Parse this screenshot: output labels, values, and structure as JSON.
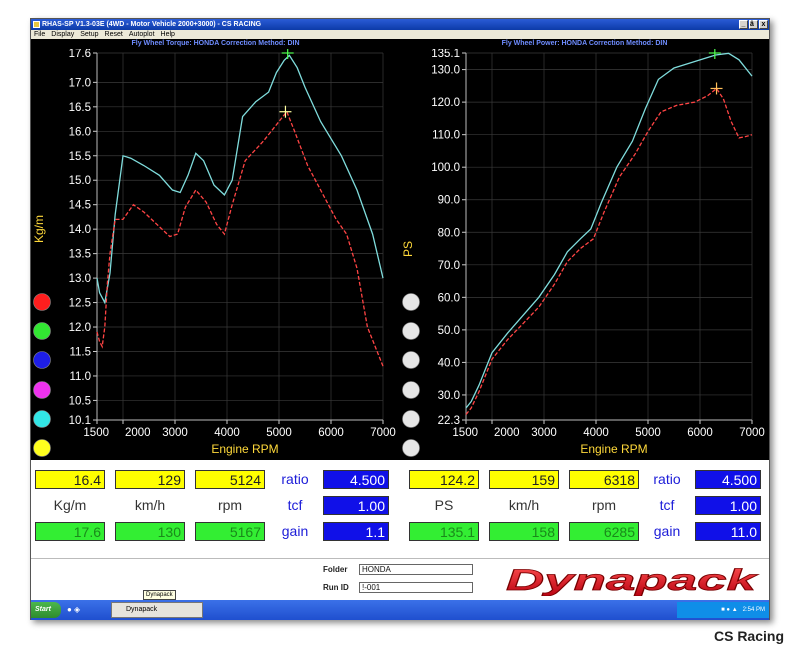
{
  "window": {
    "title": "RHAS-SP V1.3-03E (4WD - Motor Vehicle 2000+3000) - CS RACING",
    "menu": [
      "File",
      "Display",
      "Setup",
      "Reset",
      "Autoplot",
      "Help"
    ],
    "controls": [
      "_",
      "â¡",
      "x"
    ]
  },
  "torque_panel": {
    "title": "Fly Wheel Torque: HONDA     Correction Method: DIN"
  },
  "power_panel": {
    "title": "Fly Wheel Power: HONDA     Correction Method: DIN"
  },
  "chart_data": [
    {
      "type": "line",
      "title": "Fly Wheel Torque: HONDA     Correction Method: DIN",
      "xlabel": "Engine RPM",
      "ylabel": "Kg/m",
      "xlim": [
        1500,
        7000
      ],
      "ylim": [
        10.1,
        17.6
      ],
      "xticks": [
        1500,
        2000,
        3000,
        4000,
        5000,
        6000,
        7000
      ],
      "yticks": [
        10.1,
        10.5,
        11.0,
        11.5,
        12.0,
        12.5,
        13.0,
        13.5,
        14.0,
        14.5,
        15.0,
        15.5,
        16.0,
        16.5,
        17.0,
        17.6
      ],
      "grid": true,
      "series": [
        {
          "color": "#7fdcdc",
          "dash": false,
          "x": [
            1500,
            1550,
            1650,
            1750,
            1850,
            2000,
            2150,
            2400,
            2700,
            2950,
            3100,
            3250,
            3400,
            3550,
            3750,
            3950,
            4100,
            4300,
            4550,
            4800,
            4950,
            5100,
            5200,
            5350,
            5500,
            5800,
            6200,
            6500,
            6800,
            7000
          ],
          "y": [
            13.0,
            12.7,
            12.5,
            13.1,
            14.3,
            15.5,
            15.45,
            15.3,
            15.1,
            14.8,
            14.75,
            15.1,
            15.55,
            15.4,
            14.9,
            14.7,
            15.0,
            16.3,
            16.6,
            16.8,
            17.2,
            17.45,
            17.55,
            17.3,
            16.9,
            16.2,
            15.5,
            14.8,
            13.9,
            13.0
          ]
        },
        {
          "color": "#ff4444",
          "dash": true,
          "x": [
            1500,
            1550,
            1600,
            1650,
            1700,
            1750,
            1850,
            2000,
            2200,
            2400,
            2650,
            2900,
            3050,
            3200,
            3400,
            3600,
            3800,
            3950,
            4100,
            4350,
            4700,
            5000,
            5150,
            5300,
            5550,
            5850,
            6100,
            6300,
            6500,
            6700,
            6850,
            7000
          ],
          "y": [
            11.9,
            11.7,
            11.6,
            12.0,
            12.9,
            13.5,
            14.2,
            14.2,
            14.5,
            14.35,
            14.1,
            13.85,
            13.9,
            14.45,
            14.8,
            14.55,
            14.1,
            13.9,
            14.5,
            15.4,
            15.8,
            16.2,
            16.4,
            16.0,
            15.3,
            14.7,
            14.2,
            13.9,
            13.2,
            12.0,
            11.6,
            11.2
          ]
        }
      ],
      "markers": [
        {
          "x": 5167,
          "y": 17.6,
          "color": "#50ff50"
        },
        {
          "x": 5124,
          "y": 16.4,
          "color": "#ffffa0"
        }
      ],
      "legend_dots": [
        "#ff1e1e",
        "#32e632",
        "#1e1ee6",
        "#ee32ee",
        "#32e6e6",
        "#ffff1e"
      ]
    },
    {
      "type": "line",
      "title": "Fly Wheel Power: HONDA     Correction Method: DIN",
      "xlabel": "Engine RPM",
      "ylabel": "PS",
      "xlim": [
        1500,
        7000
      ],
      "ylim": [
        22.3,
        135.1
      ],
      "xticks": [
        1500,
        2000,
        3000,
        4000,
        5000,
        6000,
        7000
      ],
      "yticks": [
        22.3,
        30.0,
        40.0,
        50.0,
        60.0,
        70.0,
        80.0,
        90.0,
        100.0,
        110.0,
        120.0,
        130.0,
        135.1
      ],
      "grid": true,
      "series": [
        {
          "color": "#7fdcdc",
          "dash": false,
          "x": [
            1500,
            1600,
            1750,
            2000,
            2300,
            2600,
            2900,
            3200,
            3450,
            3700,
            3900,
            4100,
            4400,
            4700,
            4950,
            5200,
            5500,
            5800,
            6100,
            6300,
            6550,
            6750,
            7000
          ],
          "y": [
            26.0,
            28.0,
            33.0,
            43.0,
            49.0,
            54.5,
            60.0,
            67.0,
            74.0,
            78.0,
            81.0,
            89.0,
            100.0,
            108.0,
            118.0,
            127.0,
            130.5,
            132.0,
            133.5,
            134.5,
            135.0,
            133.0,
            128.0
          ]
        },
        {
          "color": "#ff4444",
          "dash": true,
          "x": [
            1500,
            1600,
            1750,
            2000,
            2300,
            2600,
            2900,
            3200,
            3450,
            3700,
            3950,
            4150,
            4450,
            4750,
            5000,
            5250,
            5550,
            5900,
            6150,
            6318,
            6450,
            6600,
            6750,
            6900,
            7000
          ],
          "y": [
            24.0,
            26.0,
            31.0,
            41.0,
            47.0,
            52.0,
            57.0,
            64.0,
            71.0,
            75.0,
            78.0,
            86.0,
            97.0,
            104.0,
            111.0,
            117.0,
            119.0,
            120.0,
            122.0,
            124.2,
            121.0,
            114.0,
            109.0,
            109.5,
            110.0
          ]
        }
      ],
      "markers": [
        {
          "x": 6285,
          "y": 135.1,
          "color": "#50ff50"
        },
        {
          "x": 6318,
          "y": 124.2,
          "color": "#ffbe5a"
        }
      ],
      "legend_dots": [
        "#e6e6e6",
        "#e6e6e6",
        "#e6e6e6",
        "#e6e6e6",
        "#e6e6e6",
        "#e6e6e6"
      ]
    }
  ],
  "readouts": {
    "left": {
      "current": {
        "torque": "16.4",
        "speed": "129",
        "rpm": "5124"
      },
      "units": {
        "torque": "Kg/m",
        "speed": "km/h",
        "rpm": "rpm"
      },
      "peak": {
        "torque": "17.6",
        "speed": "130",
        "rpm": "5167"
      },
      "ratio_label": "ratio",
      "ratio": "4.500",
      "tcf_label": "tcf",
      "tcf": "1.00",
      "gain_label": "gain",
      "gain": "1.1"
    },
    "right": {
      "current": {
        "power": "124.2",
        "speed": "159",
        "rpm": "6318"
      },
      "units": {
        "power": "PS",
        "speed": "km/h",
        "rpm": "rpm"
      },
      "peak": {
        "power": "135.1",
        "speed": "158",
        "rpm": "6285"
      },
      "ratio_label": "ratio",
      "ratio": "4.500",
      "tcf_label": "tcf",
      "tcf": "1.00",
      "gain_label": "gain",
      "gain": "11.0"
    }
  },
  "footer": {
    "folder_label": "Folder",
    "folder": "HONDA",
    "run_label": "Run ID",
    "run_id": "!-001",
    "tooltip": "Dynapack",
    "logo": "Dynapack"
  },
  "taskbar": {
    "start": "Start",
    "task": "Dynapack",
    "clock": "2:54 PM"
  },
  "watermark": "CS Racing",
  "colors": {
    "accent_blue": "#1010e8",
    "peak_green": "#33ee33",
    "current_yellow": "#ffff00",
    "logo_red": "#e0202a"
  }
}
